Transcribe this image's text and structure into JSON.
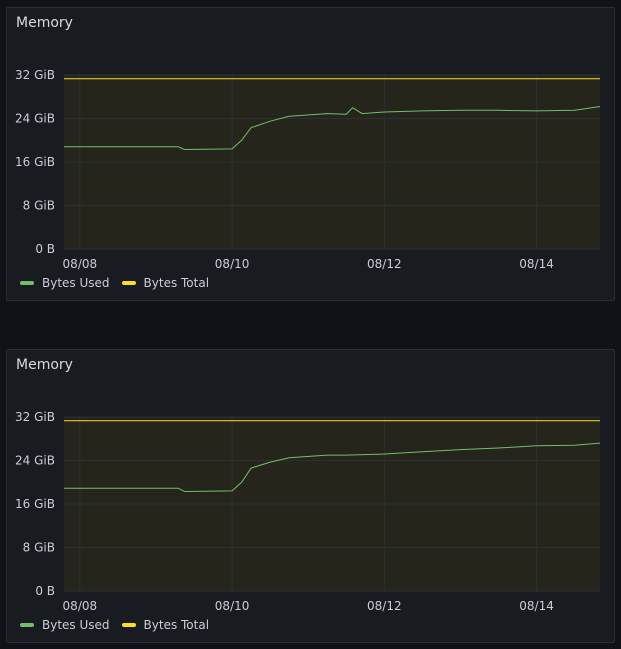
{
  "colors": {
    "used": "#73bf69",
    "total": "#fade2a",
    "grid": "#2c2f35",
    "plot_fill": "#25251c"
  },
  "panels": [
    {
      "title": "Memory",
      "legend": [
        {
          "label": "Bytes Used",
          "color": "#73bf69"
        },
        {
          "label": "Bytes Total",
          "color": "#fade2a"
        }
      ]
    },
    {
      "title": "Memory",
      "legend": [
        {
          "label": "Bytes Used",
          "color": "#73bf69"
        },
        {
          "label": "Bytes Total",
          "color": "#fade2a"
        }
      ]
    }
  ],
  "chart_data": [
    {
      "type": "line",
      "title": "Memory",
      "y_unit": "GiB",
      "ylim": [
        0,
        32
      ],
      "y_ticks": [
        "0 B",
        "8 GiB",
        "16 GiB",
        "24 GiB",
        "32 GiB"
      ],
      "y_tick_values": [
        0,
        8,
        16,
        24,
        32
      ],
      "xlim": [
        "08/07 19:00",
        "08/14 20:00"
      ],
      "x_ticks": [
        "08/08",
        "08/10",
        "08/12",
        "08/14"
      ],
      "grid": true,
      "legend_position": "bottom-left",
      "series": [
        {
          "name": "Bytes Used",
          "x": [
            "08/07 19:00",
            "08/09 07:00",
            "08/09 09:00",
            "08/10 00:00",
            "08/10 03:00",
            "08/10 06:00",
            "08/10 12:00",
            "08/10 18:00",
            "08/11 06:00",
            "08/11 12:00",
            "08/11 14:00",
            "08/11 17:00",
            "08/12 00:00",
            "08/12 12:00",
            "08/13 00:00",
            "08/13 12:00",
            "08/14 00:00",
            "08/14 12:00",
            "08/14 20:00"
          ],
          "values": [
            18.8,
            18.8,
            18.3,
            18.4,
            20.0,
            22.3,
            23.5,
            24.4,
            24.9,
            24.8,
            26.0,
            24.9,
            25.2,
            25.4,
            25.5,
            25.5,
            25.4,
            25.5,
            26.2
          ]
        },
        {
          "name": "Bytes Total",
          "x": [
            "08/07 19:00",
            "08/14 20:00"
          ],
          "values": [
            31.3,
            31.3
          ]
        }
      ]
    },
    {
      "type": "line",
      "title": "Memory",
      "y_unit": "GiB",
      "ylim": [
        0,
        32
      ],
      "y_ticks": [
        "0 B",
        "8 GiB",
        "16 GiB",
        "24 GiB",
        "32 GiB"
      ],
      "y_tick_values": [
        0,
        8,
        16,
        24,
        32
      ],
      "xlim": [
        "08/07 19:00",
        "08/14 20:00"
      ],
      "x_ticks": [
        "08/08",
        "08/10",
        "08/12",
        "08/14"
      ],
      "grid": true,
      "legend_position": "bottom-left",
      "series": [
        {
          "name": "Bytes Used",
          "x": [
            "08/07 19:00",
            "08/09 07:00",
            "08/09 09:00",
            "08/10 00:00",
            "08/10 03:00",
            "08/10 06:00",
            "08/10 12:00",
            "08/10 18:00",
            "08/11 06:00",
            "08/11 12:00",
            "08/12 00:00",
            "08/12 12:00",
            "08/13 00:00",
            "08/13 12:00",
            "08/14 00:00",
            "08/14 12:00",
            "08/14 20:00"
          ],
          "values": [
            18.9,
            18.9,
            18.3,
            18.4,
            20.0,
            22.6,
            23.7,
            24.5,
            25.0,
            25.0,
            25.2,
            25.6,
            26.0,
            26.3,
            26.7,
            26.8,
            27.2
          ]
        },
        {
          "name": "Bytes Total",
          "x": [
            "08/07 19:00",
            "08/14 20:00"
          ],
          "values": [
            31.3,
            31.3
          ]
        }
      ]
    }
  ]
}
